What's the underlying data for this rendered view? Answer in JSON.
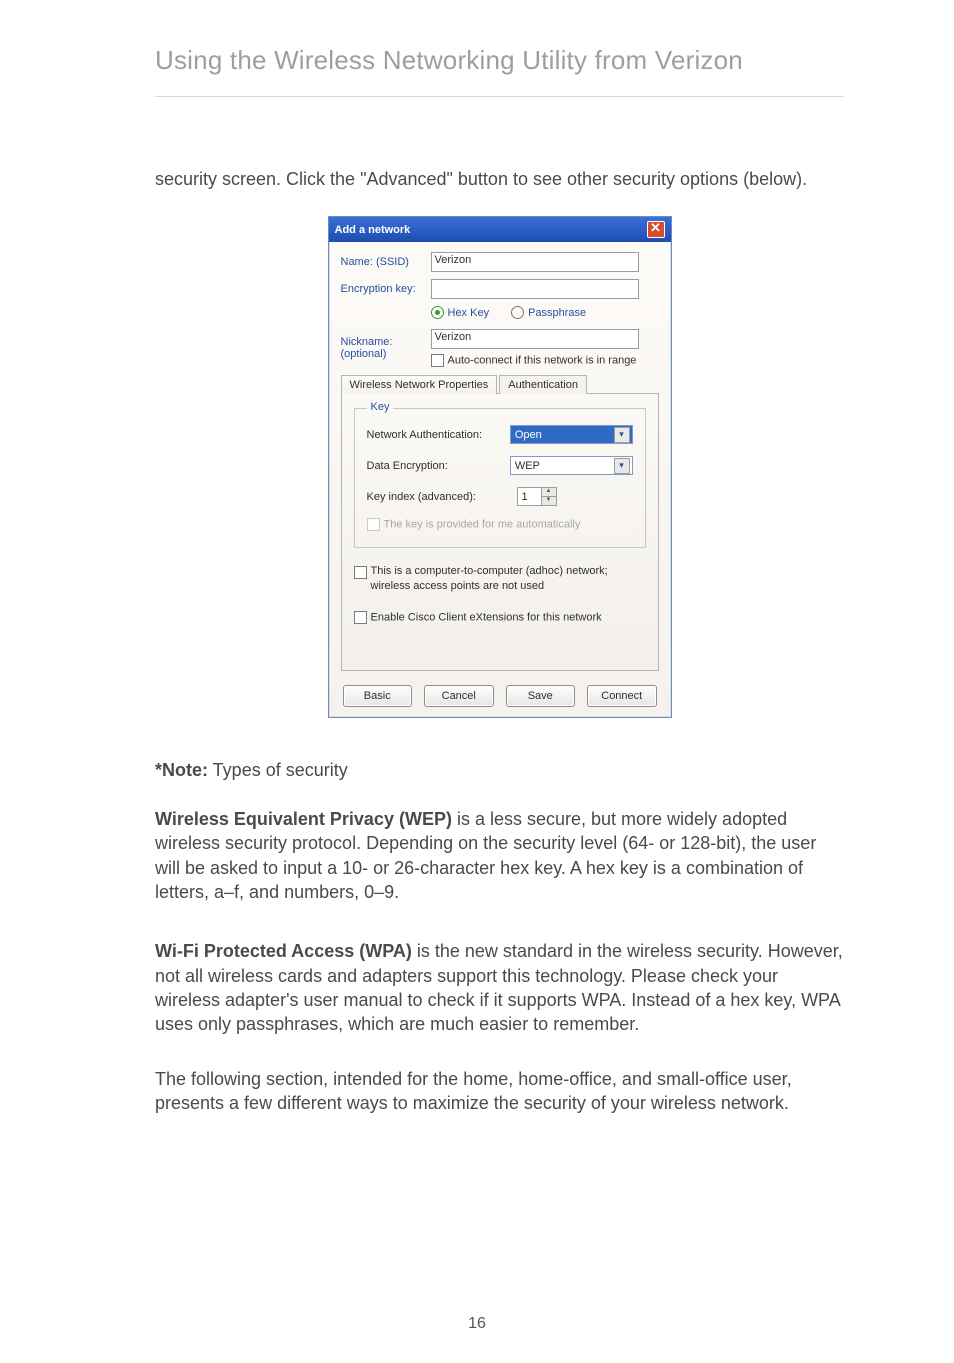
{
  "header": {
    "title": "Using the Wireless Networking Utility from Verizon"
  },
  "intro": {
    "text": "security screen. Click the \"Advanced\" button to see other security options (below)."
  },
  "dialog": {
    "title": "Add a network",
    "close_glyph": "✕",
    "name_label": "Name:  (SSID)",
    "name_value": "Verizon",
    "enc_label": "Encryption key:",
    "enc_value": "",
    "radio_hex": "Hex Key",
    "radio_pass": "Passphrase",
    "nick_label": "Nickname:",
    "nick_sub": "(optional)",
    "nick_value": "Verizon",
    "auto_connect": "Auto-connect if this network is in range",
    "tab1": "Wireless Network Properties",
    "tab2": "Authentication",
    "fieldset_legend": "Key",
    "netauth_label": "Network Authentication:",
    "netauth_value": "Open",
    "dataenc_label": "Data Encryption:",
    "dataenc_value": "WEP",
    "keyidx_label": "Key index (advanced):",
    "keyidx_value": "1",
    "key_auto": "The key is provided for me automatically",
    "adhoc": "This is a computer-to-computer (adhoc) network; wireless access points are not used",
    "cisco": "Enable Cisco Client eXtensions for this network",
    "btn_basic": "Basic",
    "btn_cancel": "Cancel",
    "btn_save": "Save",
    "btn_connect": "Connect"
  },
  "note": {
    "prefix": "*Note:",
    "rest": " Types of security"
  },
  "wep": {
    "title": "Wireless Equivalent Privacy (WEP)",
    "body": " is a less secure, but more widely adopted wireless security protocol. Depending on the security level (64- or 128-bit), the user will be asked to input a 10- or 26-character hex key. A hex key is a combination of letters, a–f, and numbers, 0–9."
  },
  "wpa": {
    "title": "Wi-Fi Protected Access (WPA)",
    "body": " is the new standard in the wireless security. However, not all wireless cards and adapters support this technology. Please check your wireless adapter's user manual to check if it supports WPA. Instead of a hex key, WPA uses only passphrases, which are much easier to remember."
  },
  "closing": {
    "text": "The following section, intended for the home, home-office, and small-office user, presents a few different ways to maximize the security of your wireless network."
  },
  "page_number": "16"
}
